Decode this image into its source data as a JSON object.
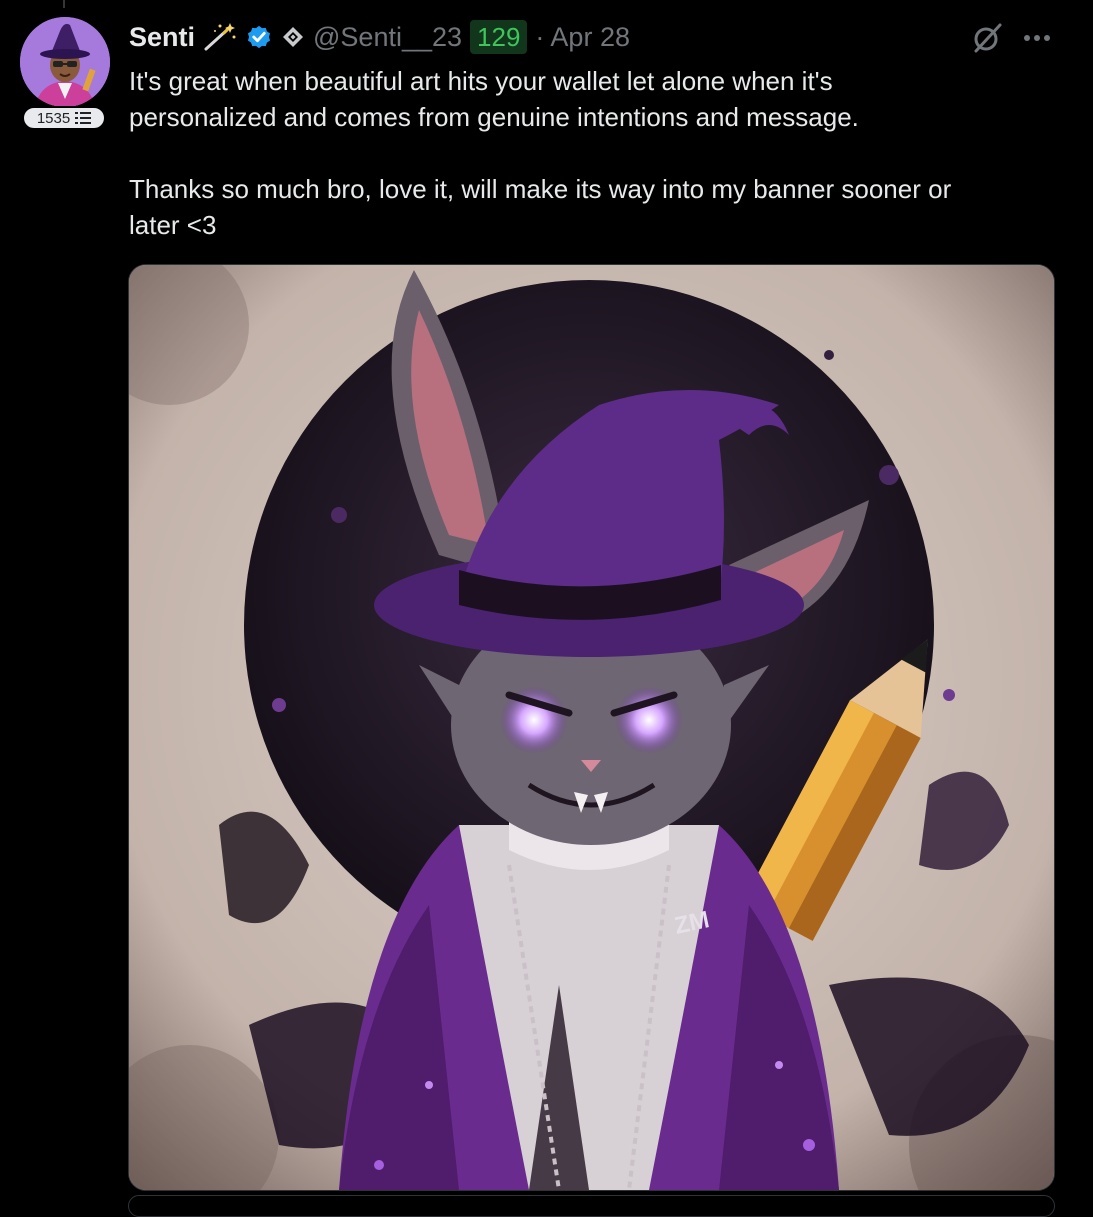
{
  "post": {
    "author": {
      "display_name": "Senti",
      "handle": "@Senti__23",
      "level_badge": "1535",
      "count_badge": "129",
      "date_separator": "·",
      "date": "Apr 28",
      "avatar_icon": "wizard-avatar"
    },
    "body": "It's great when beautiful art hits your wallet let alone when it's\npersonalized and comes from genuine intentions and message.\n\nThanks so much bro, love it, will make its way into my banner sooner or\nlater <3",
    "media": {
      "image_lettering": "ZM",
      "description_icon": "wizard-bunny-artwork"
    },
    "icons": {
      "magic_wand": "magic-wand-icon",
      "verified": "verified-badge-icon",
      "affiliate": "diamond-affiliate-icon",
      "grok": "grok-icon",
      "more": "more-icon"
    },
    "colors": {
      "verified_blue": "#1d9bf0",
      "count_green": "#3ec55b",
      "muted_text": "#71767b",
      "primary_text": "#e7e9ea",
      "art_purple": "#6a2b8e"
    }
  }
}
